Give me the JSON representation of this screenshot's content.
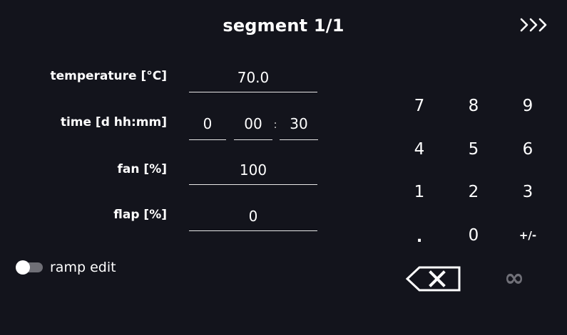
{
  "header": {
    "title": "segment 1/1",
    "next_icon": "triple-chevron-right-icon"
  },
  "form": {
    "temperature": {
      "label": "temperature [°C]",
      "value": "70.0"
    },
    "time": {
      "label": "time [d hh:mm]",
      "days": "0",
      "hours": "00",
      "separator": ":",
      "minutes": "30"
    },
    "fan": {
      "label": "fan [%]",
      "value": "100"
    },
    "flap": {
      "label": "flap [%]",
      "value": "0"
    }
  },
  "ramp_edit": {
    "label": "ramp edit",
    "enabled": false
  },
  "keypad": {
    "keys": [
      "7",
      "8",
      "9",
      "4",
      "5",
      "6",
      "1",
      "2",
      "3",
      ".",
      "0",
      "+/-"
    ],
    "backspace_icon": "backspace-icon",
    "infinity_icon": "infinity-icon",
    "infinity_symbol": "∞"
  },
  "colors": {
    "background": "#13141c",
    "text": "#ffffff",
    "disabled": "#707078"
  }
}
